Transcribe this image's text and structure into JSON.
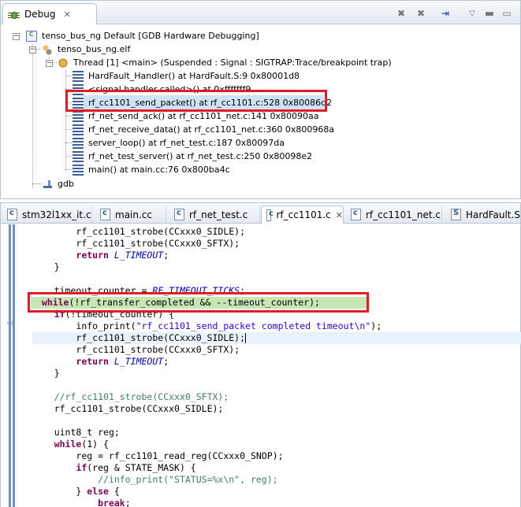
{
  "debug_view": {
    "tab_label": "Debug",
    "tree": {
      "launch": "tenso_bus_ng Default [GDB Hardware Debugging]",
      "process": "tenso_bus_ng.elf",
      "thread": "Thread [1] <main> (Suspended : Signal : SIGTRAP:Trace/breakpoint trap)",
      "frames": [
        "HardFault_Handler() at HardFault.S:9 0x80001d8",
        "<signal handler called>() at 0xfffffff9",
        "rf_cc1101_send_packet() at rf_cc1101.c:528 0x80086d2",
        "rf_net_send_ack() at rf_cc1101_net.c:141 0x80090aa",
        "rf_net_receive_data() at rf_cc1101_net.c:360 0x800968a",
        "server_loop() at rf_net_test.c:187 0x80097da",
        "rf_net_test_server() at rf_net_test.c:250 0x80098e2",
        "main() at main.cc:76 0x800ba4c"
      ],
      "gdb": "gdb"
    }
  },
  "editor": {
    "tabs": [
      "stm32l1xx_it.c",
      "main.cc",
      "rf_net_test.c",
      "rf_cc1101.c",
      "rf_cc1101_net.c",
      "HardFault.S"
    ],
    "active_tab": "rf_cc1101.c",
    "code": {
      "l1": "rf_cc1101_strobe(CCxxx0_SIDLE);",
      "l2": "rf_cc1101_strobe(CCxxx0_SFTX);",
      "l3_kw": "return",
      "l3_mac": "L_TIMEOUT",
      "l4": "}",
      "l6_a": "timeout_counter = ",
      "l6_mac": "RF_TIMEOUT_TICKS",
      "l7_kw": "while",
      "l7": "(!rf_transfer_completed && --timeout_counter);",
      "l8_kw": "if",
      "l8": "(!timeout_counter) {",
      "l9_a": "info_print(",
      "l9_str": "\"rf_cc1101_send_packet completed timeout\\n\"",
      "l9_b": ");",
      "l10": "rf_cc1101_strobe(CCxxx0_SIDLE);",
      "l11": "rf_cc1101_strobe(CCxxx0_SFTX);",
      "l12_kw": "return",
      "l12_mac": "L_TIMEOUT",
      "l13": "}",
      "l15_cm": "//rf_cc1101_strobe(CCxxx0_SFTX);",
      "l16": "rf_cc1101_strobe(CCxxx0_SIDLE);",
      "l18": "uint8_t reg;",
      "l19_kw": "while",
      "l19": "(1) {",
      "l20": "reg = rf_cc1101_read_reg(CCxxx0_SNOP);",
      "l21_kw": "if",
      "l21": "(reg & STATE_MASK) {",
      "l22_cm": "//info_print(\"STATUS=%x\\n\", reg);",
      "l23_a": "} ",
      "l23_kw": "else",
      "l23_b": " {",
      "l24_kw": "break",
      "l24": ";"
    }
  },
  "colors": {
    "highlight_box": "#e21b24",
    "exec_line": "#c5e7b4",
    "keyword": "#7f0055",
    "string": "#2a00ff",
    "comment": "#3f7f5f"
  }
}
